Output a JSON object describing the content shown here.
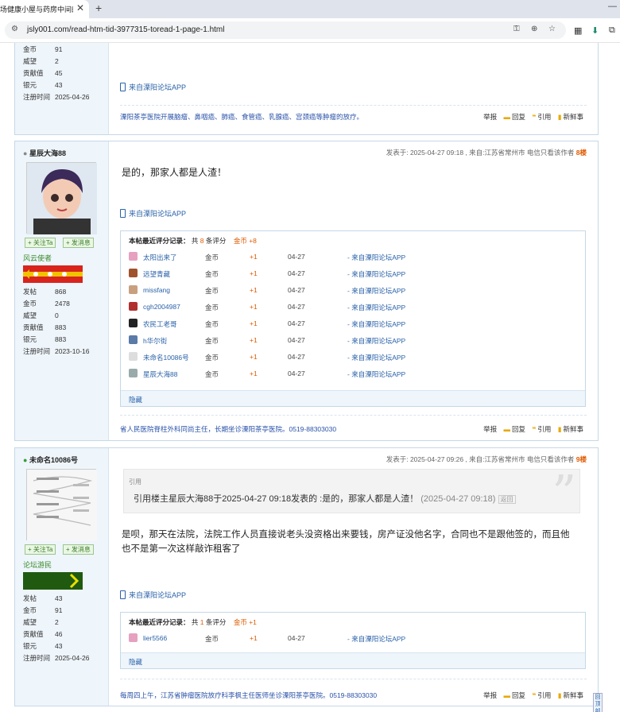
{
  "browser": {
    "tab_title": "场健康小屋与药房中间的",
    "url": "jsly001.com/read-htm-tid-3977315-toread-1-page-1.html"
  },
  "post0": {
    "stats": [
      {
        "k": "金币",
        "v": "91"
      },
      {
        "k": "威望",
        "v": "2"
      },
      {
        "k": "贡献值",
        "v": "45"
      },
      {
        "k": "银元",
        "v": "43"
      },
      {
        "k": "注册时间",
        "v": "2025-04-26"
      }
    ],
    "app_link": "来自溧阳论坛APP",
    "signature": "溧阳茶亭医院开展脑瘤、鼻咽癌、肺癌、食管癌、乳腺癌、宫颈癌等肿瘤的放疗。",
    "actions": [
      "举报",
      "回复",
      "引用",
      "新鲜事"
    ]
  },
  "post1": {
    "username": "星辰大海88",
    "follow_btn": "+ 关注Ta",
    "msg_btn": "+ 发消息",
    "group": "风云使者",
    "stats": [
      {
        "k": "发帖",
        "v": "868"
      },
      {
        "k": "金币",
        "v": "2478"
      },
      {
        "k": "威望",
        "v": "0"
      },
      {
        "k": "贡献值",
        "v": "883"
      },
      {
        "k": "银元",
        "v": "883"
      },
      {
        "k": "注册时间",
        "v": "2023-10-16"
      }
    ],
    "meta": "发表于: 2025-04-27 09:18 , 来自:江苏省常州市 电信只看该作者",
    "floor": "8楼",
    "body": "是的，那家人都是人渣！",
    "app_link": "来自溧阳论坛APP",
    "rating": {
      "label": "本帖最近评分记录：",
      "count_text_pre": "共",
      "count": "8",
      "count_text_post": "条评分",
      "total": "金币 +8",
      "rows": [
        {
          "user": "太阳出来了",
          "cur": "金币",
          "amt": "+1",
          "date": "04-27",
          "src": "- 来自溧阳论坛APP"
        },
        {
          "user": "远望青藏",
          "cur": "金币",
          "amt": "+1",
          "date": "04-27",
          "src": "- 来自溧阳论坛APP"
        },
        {
          "user": "missfang",
          "cur": "金币",
          "amt": "+1",
          "date": "04-27",
          "src": "- 来自溧阳论坛APP"
        },
        {
          "user": "cgh2004987",
          "cur": "金币",
          "amt": "+1",
          "date": "04-27",
          "src": "- 来自溧阳论坛APP"
        },
        {
          "user": "农民工老哥",
          "cur": "金币",
          "amt": "+1",
          "date": "04-27",
          "src": "- 来自溧阳论坛APP"
        },
        {
          "user": "h华尔街",
          "cur": "金币",
          "amt": "+1",
          "date": "04-27",
          "src": "- 来自溧阳论坛APP"
        },
        {
          "user": "未命名10086号",
          "cur": "金币",
          "amt": "+1",
          "date": "04-27",
          "src": "- 来自溧阳论坛APP"
        },
        {
          "user": "星辰大海88",
          "cur": "金币",
          "amt": "+1",
          "date": "04-27",
          "src": "- 来自溧阳论坛APP"
        }
      ],
      "hide": "隐藏"
    },
    "signature": "省人民医院脊柱外科同尚主任，长期坐诊溧阳茶亭医院。0519-88303030",
    "actions": [
      "举报",
      "回复",
      "引用",
      "新鲜事"
    ]
  },
  "post2": {
    "username": "未命名10086号",
    "follow_btn": "+ 关注Ta",
    "msg_btn": "+ 发消息",
    "group": "论坛游民",
    "stats": [
      {
        "k": "发帖",
        "v": "43"
      },
      {
        "k": "金币",
        "v": "91"
      },
      {
        "k": "威望",
        "v": "2"
      },
      {
        "k": "贡献值",
        "v": "46"
      },
      {
        "k": "银元",
        "v": "43"
      },
      {
        "k": "注册时间",
        "v": "2025-04-26"
      }
    ],
    "meta": "发表于: 2025-04-27 09:26 , 来自:江苏省常州市 电信只看该作者",
    "floor": "9楼",
    "quote": {
      "label": "引用",
      "text": "引用楼主星辰大海88于2025-04-27 09:18发表的 :是的，那家人都是人渣！",
      "date": "(2025-04-27 09:18)",
      "back": "返回"
    },
    "body": "是呗，那天在法院，法院工作人员直接说老头没资格出来要钱，房产证没他名字，合同也不是跟他签的，而且他也不是第一次这样敲诈租客了",
    "app_link": "来自溧阳论坛APP",
    "rating": {
      "label": "本帖最近评分记录：",
      "count_text_pre": "共",
      "count": "1",
      "count_text_post": "条评分",
      "total": "金币 +1",
      "rows": [
        {
          "user": "lier5566",
          "cur": "金币",
          "amt": "+1",
          "date": "04-27",
          "src": "- 来自溧阳论坛APP"
        }
      ],
      "hide": "隐藏"
    },
    "signature": "每周四上午，江苏省肿瘤医院放疗科李枫主任医师坐诊溧阳茶亭医院。0519-88303030",
    "actions": [
      "举报",
      "回复",
      "引用",
      "新鲜事"
    ]
  },
  "back_to_top": "回顶部"
}
